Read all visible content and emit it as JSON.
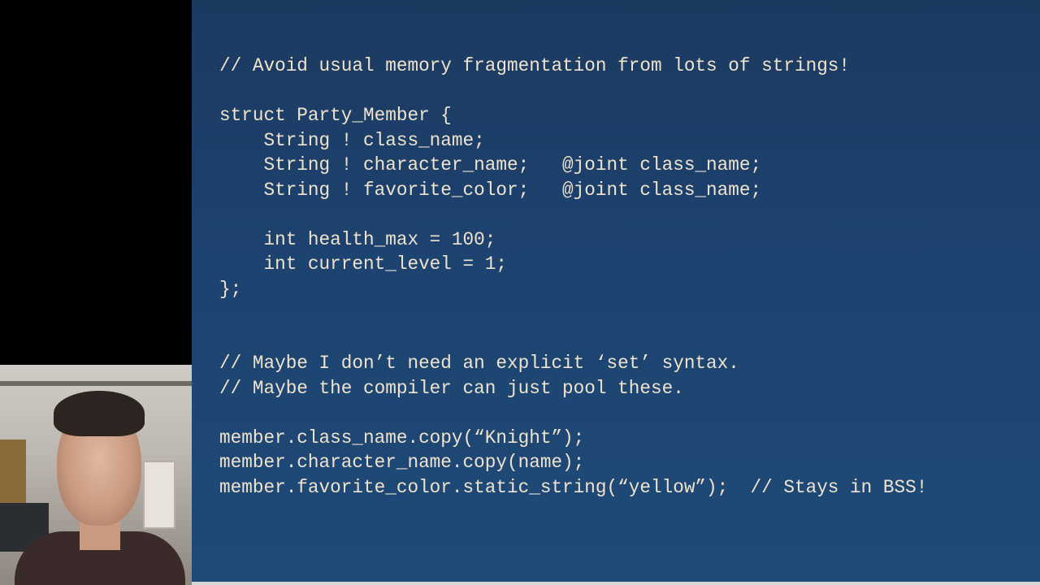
{
  "slide": {
    "lines": [
      "// Avoid usual memory fragmentation from lots of strings!",
      "",
      "struct Party_Member {",
      "    String ! class_name;",
      "    String ! character_name;   @joint class_name;",
      "    String ! favorite_color;   @joint class_name;",
      "",
      "    int health_max = 100;",
      "    int current_level = 1;",
      "};",
      "",
      "",
      "// Maybe I don’t need an explicit ‘set’ syntax.",
      "// Maybe the compiler can just pool these.",
      "",
      "member.class_name.copy(“Knight”);",
      "member.character_name.copy(name);",
      "member.favorite_color.static_string(“yellow”);  // Stays in BSS!"
    ]
  },
  "colors": {
    "slide_background": "#1d4370",
    "code_text": "#efe3cd",
    "letterbox": "#000000"
  }
}
